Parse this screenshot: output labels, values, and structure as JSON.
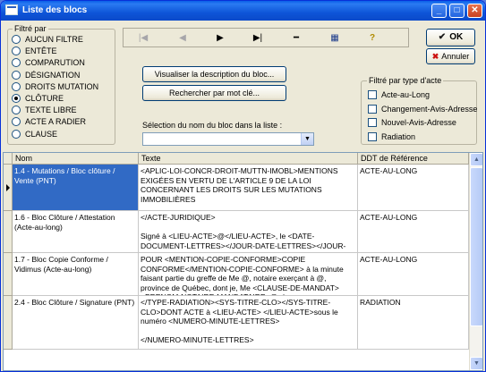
{
  "window": {
    "title": "Liste des blocs",
    "controls": {
      "minimize": "_",
      "maximize": "□",
      "close": "✕"
    }
  },
  "filter_group": {
    "legend": "Filtré par",
    "options": [
      {
        "label": "AUCUN FILTRE",
        "selected": false
      },
      {
        "label": "ENTÊTE",
        "selected": false
      },
      {
        "label": "COMPARUTION",
        "selected": false
      },
      {
        "label": "DÉSIGNATION",
        "selected": false
      },
      {
        "label": "DROITS MUTATION",
        "selected": false
      },
      {
        "label": "CLÔTURE",
        "selected": true
      },
      {
        "label": "TEXTE LIBRE",
        "selected": false
      },
      {
        "label": "ACTE A RADIER",
        "selected": false
      },
      {
        "label": "CLAUSE",
        "selected": false
      }
    ]
  },
  "toolbar": {
    "first": "|◀",
    "prev": "◀",
    "next": "▶",
    "last": "▶|",
    "delete": "━",
    "grid": "▦",
    "help": "?"
  },
  "buttons": {
    "view_description": "Visualiser la description du bloc...",
    "search_keyword": "Rechercher par mot clé...",
    "ok": "OK",
    "cancel": "Annuler"
  },
  "selection": {
    "label": "Sélection du nom du bloc dans la liste :",
    "value": ""
  },
  "act_type_group": {
    "legend": "Filtré par type d'acte",
    "options": [
      {
        "label": "Acte-au-Long",
        "checked": false
      },
      {
        "label": "Changement-Avis-Adresse",
        "checked": false
      },
      {
        "label": "Nouvel-Avis-Adresse",
        "checked": false
      },
      {
        "label": "Radiation",
        "checked": false
      }
    ]
  },
  "table": {
    "columns": [
      "Nom",
      "Texte",
      "DDT de Référence"
    ],
    "rows": [
      {
        "nom": "1.4 - Mutations / Bloc clôture / Vente (PNT)",
        "texte": "<APLIC-LOI-CONCR-DROIT-MUTTN-IMOBL>MENTIONS EXIGÉES EN VERTU DE L'ARTICLE 9 DE LA LOI CONCERNANT LES DROITS SUR LES MUTATIONS IMMOBILIÈRES\n\nLes parties font les déclarations suivantes:",
        "ddt": "ACTE-AU-LONG",
        "selected": true
      },
      {
        "nom": "1.6 - Bloc Clôture / Attestation (Acte-au-long)",
        "texte": "</ACTE-JURIDIQUE>\n\nSigné à <LIEU-ACTE>@</LIEU-ACTE>, le <DATE-DOCUMENT-LETTRES></JOUR-DATE-LETTRES></JOUR-MOIS-DATE-LETTRES></MOIS-DATE-LETTRES>",
        "ddt": "ACTE-AU-LONG",
        "selected": false
      },
      {
        "nom": "1.7 - Bloc Copie Conforme / Vidimus (Acte-au-long)",
        "texte": "POUR <MENTION-COPIE-CONFORME>COPIE CONFORME</MENTION-COPIE-CONFORME> à la minute faisant partie du greffe de Me @, notaire exerçant à @, province de Québec, dont je, Me <CLAUSE-DE-MANDAT><PRENOM-NOTAIRE-MANDATAIRE>@</",
        "ddt": "ACTE-AU-LONG",
        "selected": false
      },
      {
        "nom": "2.4 - Bloc Clôture / Signature (PNT)",
        "texte": "</TYPE-RADIATION><SYS-TITRE-CLO></SYS-TITRE-CLO>DONT ACTE à <LIEU-ACTE> </LIEU-ACTE>sous le numéro <NUMERO-MINUTE-LETTRES>\n\n</NUMERO-MINUTE-LETTRES>",
        "ddt": "RADIATION",
        "selected": false
      }
    ]
  }
}
